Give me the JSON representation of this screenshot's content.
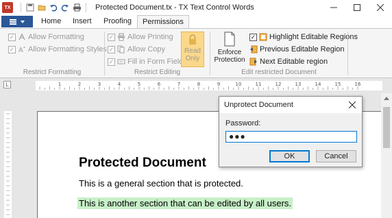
{
  "window": {
    "app_icon_text": "TX",
    "title": "Protected Document.tx - TX Text Control Words"
  },
  "quick_access": {
    "icons": [
      "save-icon",
      "open-folder-icon",
      "undo-icon",
      "redo-icon",
      "print-icon"
    ]
  },
  "tabs": [
    {
      "label": "Home"
    },
    {
      "label": "Insert"
    },
    {
      "label": "Proofing"
    },
    {
      "label": "Permissions",
      "active": true
    }
  ],
  "ribbon": {
    "restrict_formatting": {
      "label": "Restrict Formatting",
      "allow_formatting": "Allow Formatting",
      "allow_formatting_styles": "Allow Formatting Styles"
    },
    "restrict_editing": {
      "label": "Restrict Editing",
      "allow_printing": "Allow Printing",
      "allow_copy": "Allow Copy",
      "fill_in_form_fields": "Fill in Form Fields",
      "read_only_line1": "Read",
      "read_only_line2": "Only"
    },
    "edit_restricted_document": {
      "label": "Edit restricted Document",
      "enforce_line1": "Enforce",
      "enforce_line2": "Protection",
      "highlight_editable_regions": "Highlight Editable Regions",
      "previous_editable_region": "Previous Editable Region",
      "next_editable_region": "Next Editable region"
    }
  },
  "ruler": {
    "corner_label": "L",
    "numbers": [
      "1",
      "2",
      "3",
      "4",
      "5",
      "6",
      "7",
      "8",
      "9",
      "10",
      "11",
      "12",
      "13",
      "14",
      "15",
      "16"
    ]
  },
  "document": {
    "title": "Protected Document",
    "paragraph1": "This is a general section that is protected.",
    "paragraph2": "This is another section that can be edited by all users."
  },
  "dialog": {
    "title": "Unprotect Document",
    "password_label": "Password:",
    "password_value": "●●●",
    "ok_label": "OK",
    "cancel_label": "Cancel"
  },
  "colors": {
    "file_tab": "#2b5797",
    "editable_highlight": "#c8f0c8",
    "read_only_button": "#fbd88a",
    "dialog_focus": "#0078d7"
  }
}
